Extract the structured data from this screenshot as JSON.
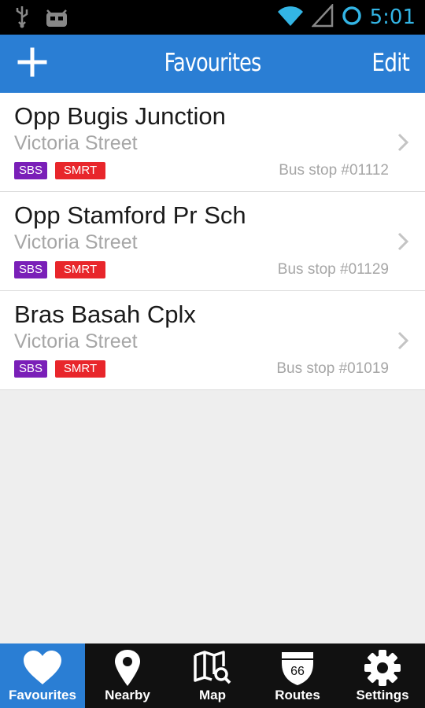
{
  "status_bar": {
    "time": "5:01",
    "icons": [
      "usb-icon",
      "android-debug-icon",
      "wifi-icon",
      "signal-icon",
      "sync-icon"
    ]
  },
  "app_bar": {
    "title": "Favourites",
    "add_icon": "plus-icon",
    "edit_label": "Edit",
    "color": "#2a7ed4"
  },
  "stops": [
    {
      "name": "Opp Bugis Junction",
      "street": "Victoria Street",
      "badges": [
        "SBS",
        "SMRT"
      ],
      "code": "Bus stop #01112"
    },
    {
      "name": "Opp Stamford Pr Sch",
      "street": "Victoria Street",
      "badges": [
        "SBS",
        "SMRT"
      ],
      "code": "Bus stop #01129"
    },
    {
      "name": "Bras Basah Cplx",
      "street": "Victoria Street",
      "badges": [
        "SBS",
        "SMRT"
      ],
      "code": "Bus stop #01019"
    }
  ],
  "badge_colors": {
    "SBS": "#7a1fb8",
    "SMRT": "#e8262b"
  },
  "tabs": [
    {
      "label": "Favourites",
      "icon": "heart-icon",
      "active": true
    },
    {
      "label": "Nearby",
      "icon": "location-pin-icon",
      "active": false
    },
    {
      "label": "Map",
      "icon": "map-search-icon",
      "active": false
    },
    {
      "label": "Routes",
      "icon": "route-shield-icon",
      "icon_text": "66",
      "active": false
    },
    {
      "label": "Settings",
      "icon": "gear-icon",
      "active": false
    }
  ]
}
